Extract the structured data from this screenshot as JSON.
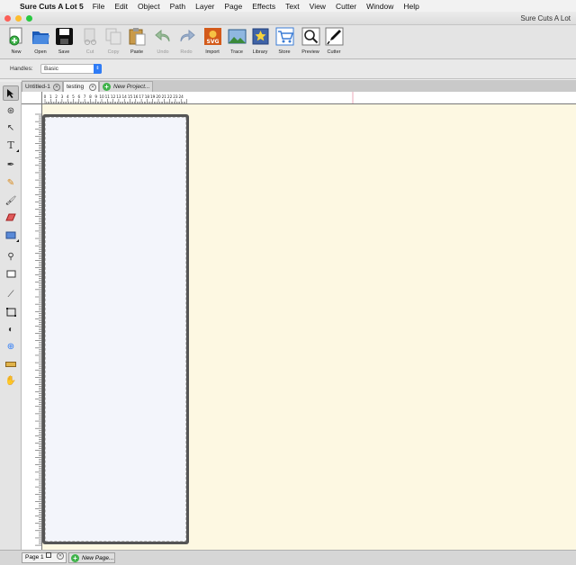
{
  "menubar": {
    "app_name": "Sure Cuts A Lot 5",
    "items": [
      "File",
      "Edit",
      "Object",
      "Path",
      "Layer",
      "Page",
      "Effects",
      "Text",
      "View",
      "Cutter",
      "Window",
      "Help"
    ]
  },
  "window": {
    "title": "Sure Cuts A Lot"
  },
  "toolbar": {
    "new": "New",
    "open": "Open",
    "save": "Save",
    "cut": "Cut",
    "copy": "Copy",
    "paste": "Paste",
    "undo": "Undo",
    "redo": "Redo",
    "import": "Import",
    "trace": "Trace",
    "library": "Library",
    "store": "Store",
    "preview": "Preview",
    "cutter": "Cutter"
  },
  "handles": {
    "label": "Handles:",
    "value": "Basic"
  },
  "tabs": {
    "tab1": "Untitled-1",
    "tab2": "testing",
    "new_project": "New Project..."
  },
  "ruler": {
    "top_ticks": [
      "0",
      "1",
      "2",
      "3",
      "4",
      "5",
      "6",
      "7",
      "8",
      "9",
      "10",
      "11",
      "12",
      "13",
      "14",
      "15",
      "16",
      "17",
      "18",
      "19",
      "20",
      "21",
      "22",
      "23",
      "24"
    ]
  },
  "pages": {
    "page1": "Page 1",
    "new_page": "New Page..."
  },
  "colors": {
    "canvas": "#fdf8e2",
    "mat": "#555555",
    "mat_inner": "#f3f5fb",
    "accent": "#2f7cf6",
    "add_green": "#3fb34a"
  }
}
